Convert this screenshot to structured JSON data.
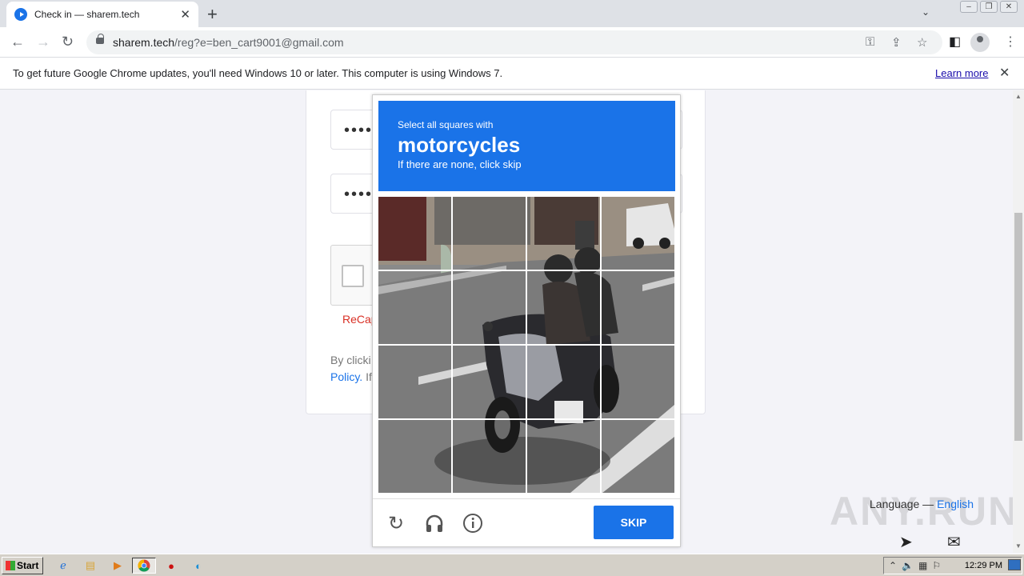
{
  "browser": {
    "tab_title": "Check in — sharem.tech",
    "url_domain": "sharem.tech",
    "url_path": "/reg?e=ben_cart9001@gmail.com",
    "infobar_message": "To get future Google Chrome updates, you'll need Windows 10 or later. This computer is using Windows 7.",
    "infobar_link": "Learn more"
  },
  "page": {
    "password_mask_1": "•••••",
    "password_mask_2": "•••••",
    "recaptcha_label": "ReCap",
    "terms_prefix": "By clicki",
    "terms_policy": "Policy.",
    "terms_suffix": " If",
    "language_label": "Language —",
    "language_value": "English",
    "watermark": "ANY.RUN"
  },
  "captcha": {
    "instruction": "Select all squares with",
    "target": "motorcycles",
    "hint": "If there are none, click skip",
    "skip_label": "SKIP",
    "accent_color": "#1a73e8"
  },
  "taskbar": {
    "start_label": "Start",
    "clock": "12:29 PM"
  }
}
